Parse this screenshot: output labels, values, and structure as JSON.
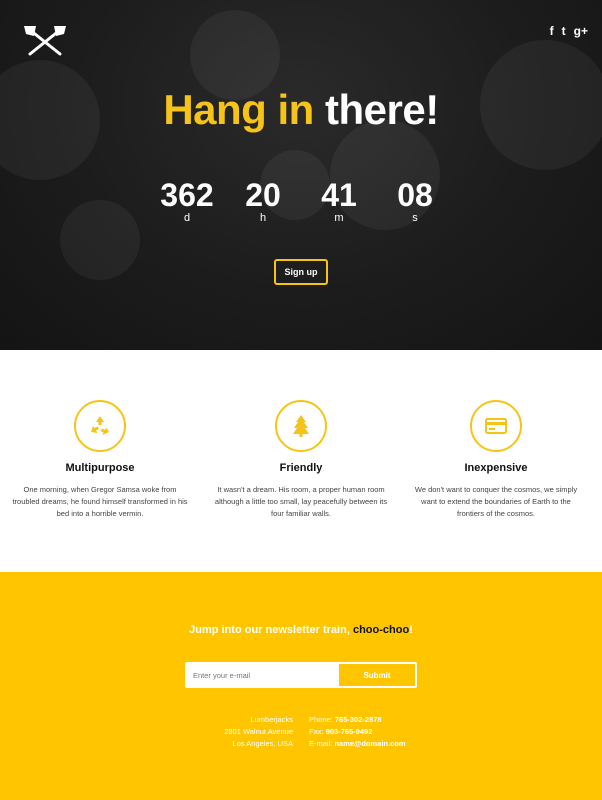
{
  "hero": {
    "headline_yellow": "Hang in",
    "headline_white": "there!",
    "countdown": [
      {
        "value": "362",
        "unit": "d"
      },
      {
        "value": "20",
        "unit": "h"
      },
      {
        "value": "41",
        "unit": "m"
      },
      {
        "value": "08",
        "unit": "s"
      }
    ],
    "signup_label": "Sign up",
    "social": [
      "f",
      "t",
      "g+"
    ],
    "accent_color": "#f6c418"
  },
  "features": [
    {
      "icon": "recycle-icon",
      "title": "Multipurpose",
      "text": "One morning, when Gregor Samsa woke from troubled dreams, he found himself transformed in his bed into a horrible vermin."
    },
    {
      "icon": "tree-icon",
      "title": "Friendly",
      "text": "It wasn't a dream. His room, a proper human room although a little too small, lay peacefully between its four familiar walls."
    },
    {
      "icon": "credit-card-icon",
      "title": "Inexpensive",
      "text": "We don't want to conquer the cosmos, we simply want to extend the boundaries of Earth to the frontiers of the cosmos."
    }
  ],
  "newsletter": {
    "title_prefix": "Jump into our newsletter train,",
    "title_highlight": "choo-choo",
    "title_suffix": "!",
    "email_placeholder": "Enter your e-mail",
    "submit_label": "Submit",
    "background_color": "#ffc600"
  },
  "contact": {
    "company": "Lumberjacks",
    "street": "2801 Walnut Avenue",
    "city": "Los Angeles, USA",
    "phone_label": "Phone:",
    "phone": "765-302-2878",
    "fax_label": "Fax:",
    "fax": "903-765-9492",
    "email_label": "E-mail:",
    "email": "name@domain.com"
  }
}
